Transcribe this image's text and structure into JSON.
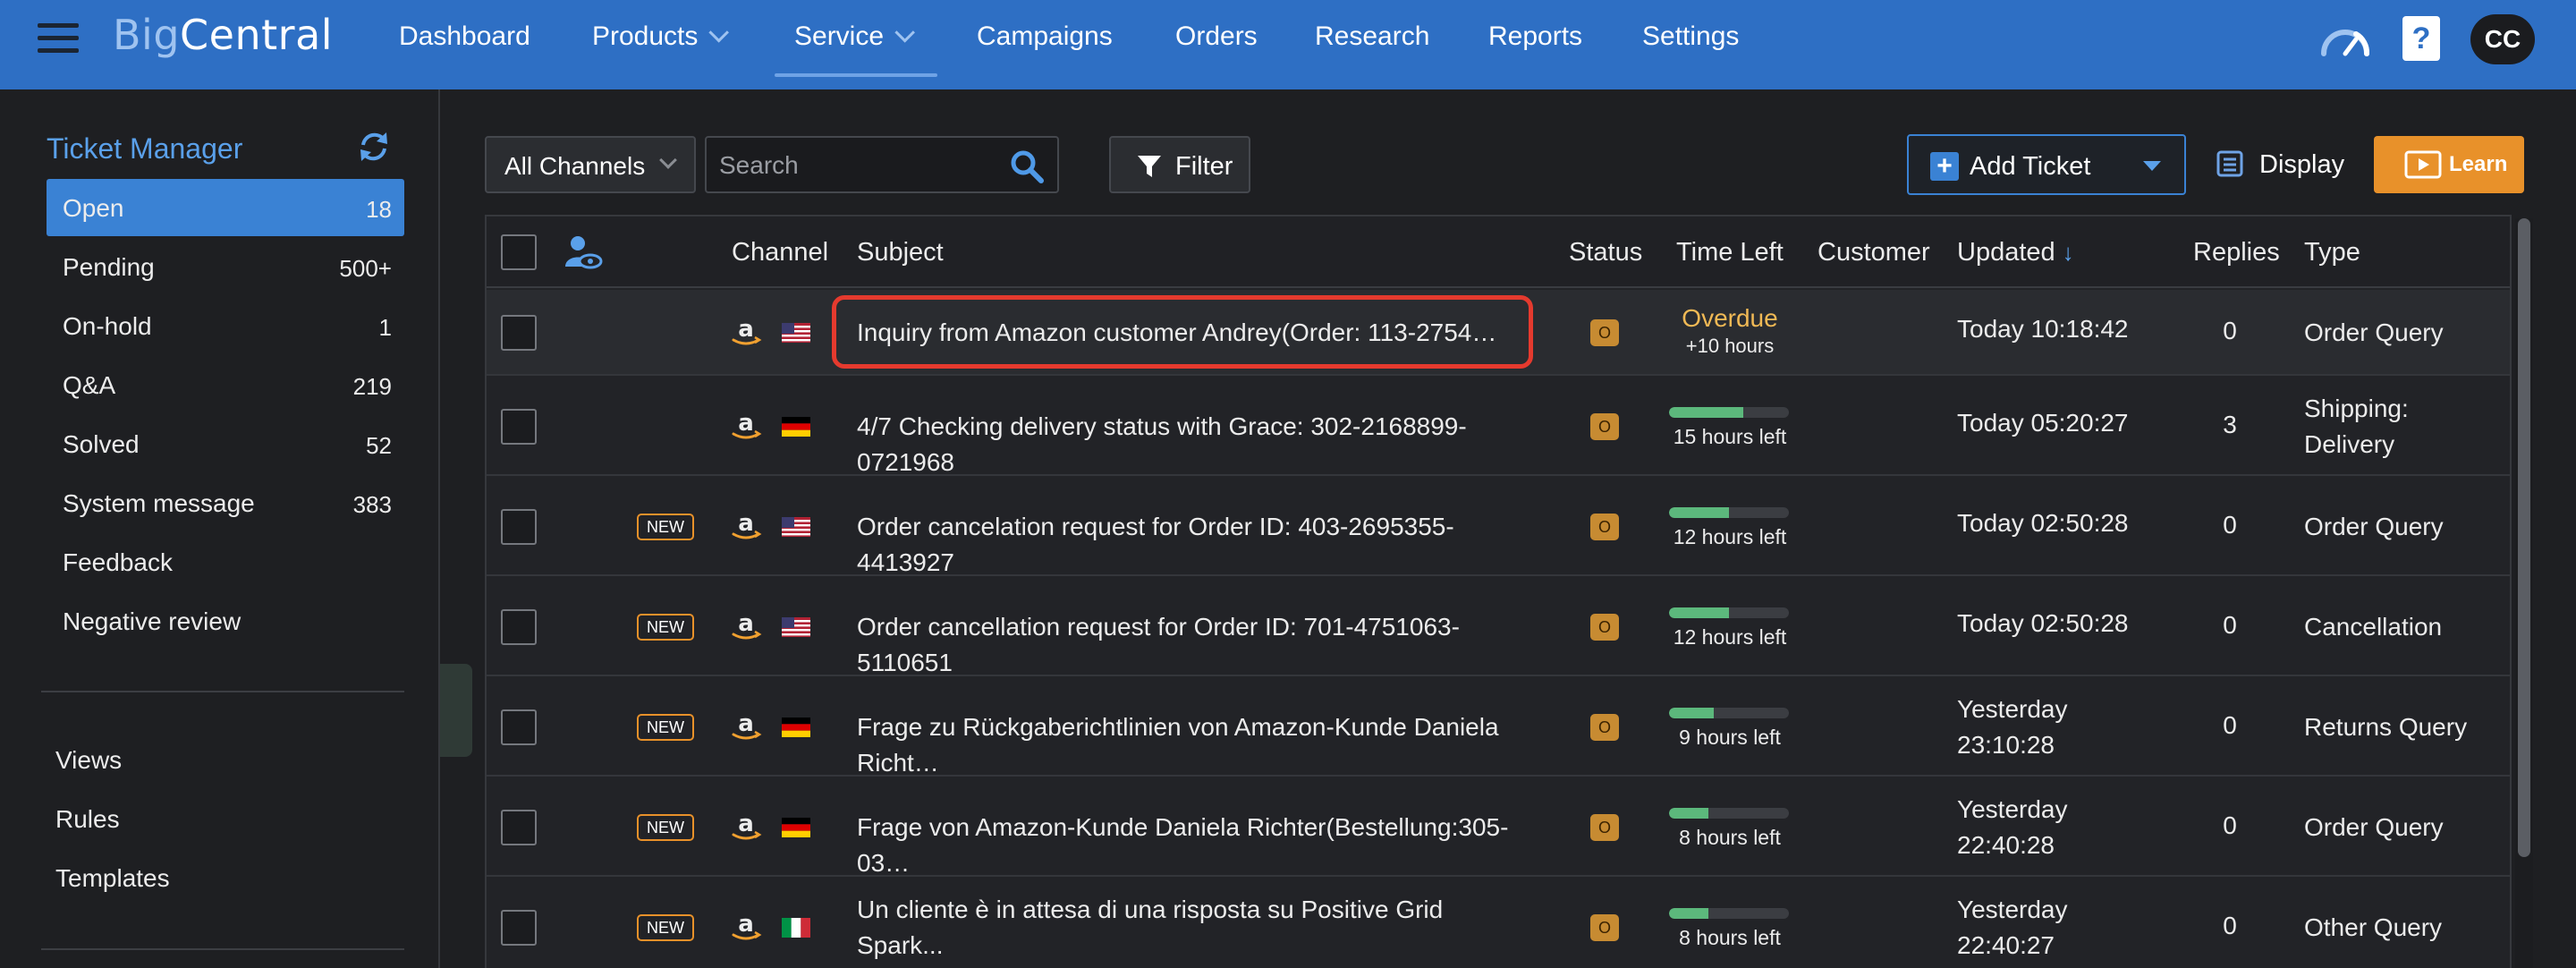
{
  "app": {
    "logo_part1": "Big",
    "logo_part2": "Central"
  },
  "nav": {
    "items": [
      "Dashboard",
      "Products",
      "Service",
      "Campaigns",
      "Orders",
      "Research",
      "Reports",
      "Settings"
    ],
    "active": "Service",
    "help_icon_text": "?",
    "avatar_initials": "CC"
  },
  "sidebar": {
    "title": "Ticket Manager",
    "items": [
      {
        "label": "Open",
        "count": "18"
      },
      {
        "label": "Pending",
        "count": "500+"
      },
      {
        "label": "On-hold",
        "count": "1"
      },
      {
        "label": "Q&A",
        "count": "219"
      },
      {
        "label": "Solved",
        "count": "52"
      },
      {
        "label": "System message",
        "count": "383"
      },
      {
        "label": "Feedback",
        "count": ""
      },
      {
        "label": "Negative review",
        "count": ""
      }
    ],
    "links": [
      "Views",
      "Rules",
      "Templates"
    ]
  },
  "toolbar": {
    "channel_select": "All Channels",
    "search_placeholder": "Search",
    "filter_label": "Filter",
    "add_ticket_label": "Add Ticket",
    "display_label": "Display",
    "learn_label": "Learn"
  },
  "table": {
    "headers": {
      "channel": "Channel",
      "subject": "Subject",
      "status": "Status",
      "time_left": "Time Left",
      "customer": "Customer",
      "updated": "Updated",
      "replies": "Replies",
      "type": "Type"
    },
    "sort_arrow": "↓",
    "new_badge_text": "NEW",
    "rows": [
      {
        "is_new": false,
        "flag": "US",
        "subject": "Inquiry from Amazon customer Andrey(Order: 113-2754…",
        "status": "O",
        "overdue": "Overdue",
        "overdue_sub": "+10 hours",
        "time_left": "",
        "progress": null,
        "updated": "Today 10:18:42",
        "replies": "0",
        "type": "Order Query"
      },
      {
        "is_new": false,
        "flag": "DE",
        "subject": "4/7 Checking delivery status with Grace: 302-2168899-0721968",
        "status": "O",
        "overdue": "",
        "overdue_sub": "",
        "time_left": "15 hours left",
        "progress": 0.62,
        "updated": "Today 05:20:27",
        "replies": "3",
        "type": "Shipping: Delivery"
      },
      {
        "is_new": true,
        "flag": "US",
        "subject": "Order cancelation request for Order ID: 403-2695355-4413927",
        "status": "O",
        "overdue": "",
        "overdue_sub": "",
        "time_left": "12 hours left",
        "progress": 0.5,
        "updated": "Today 02:50:28",
        "replies": "0",
        "type": "Order Query"
      },
      {
        "is_new": true,
        "flag": "US",
        "subject": "Order cancellation request for Order ID: 701-4751063-5110651",
        "status": "O",
        "overdue": "",
        "overdue_sub": "",
        "time_left": "12 hours left",
        "progress": 0.5,
        "updated": "Today 02:50:28",
        "replies": "0",
        "type": "Cancellation"
      },
      {
        "is_new": true,
        "flag": "DE",
        "subject": "Frage zu Rückgaberichtlinien von Amazon-Kunde Daniela Richt…",
        "status": "O",
        "overdue": "",
        "overdue_sub": "",
        "time_left": "9 hours left",
        "progress": 0.37,
        "updated": "Yesterday 23:10:28",
        "replies": "0",
        "type": "Returns Query"
      },
      {
        "is_new": true,
        "flag": "DE",
        "subject": "Frage von Amazon-Kunde Daniela Richter(Bestellung:305-03…",
        "status": "O",
        "overdue": "",
        "overdue_sub": "",
        "time_left": "8 hours left",
        "progress": 0.33,
        "updated": "Yesterday 22:40:28",
        "replies": "0",
        "type": "Order Query"
      },
      {
        "is_new": true,
        "flag": "IT",
        "subject": "Un cliente è in attesa di una risposta su Positive Grid Spark...",
        "status": "O",
        "overdue": "",
        "overdue_sub": "",
        "time_left": "8 hours left",
        "progress": 0.33,
        "updated": "Yesterday 22:40:27",
        "replies": "0",
        "type": "Other Query"
      }
    ]
  },
  "colors": {
    "topbar": "#2e6fc4",
    "accent_blue": "#3a82d4",
    "learn_orange": "#e8912a",
    "overdue": "#f0b955",
    "progress_green": "#5cb87c",
    "highlight_red": "#e53a2e"
  }
}
